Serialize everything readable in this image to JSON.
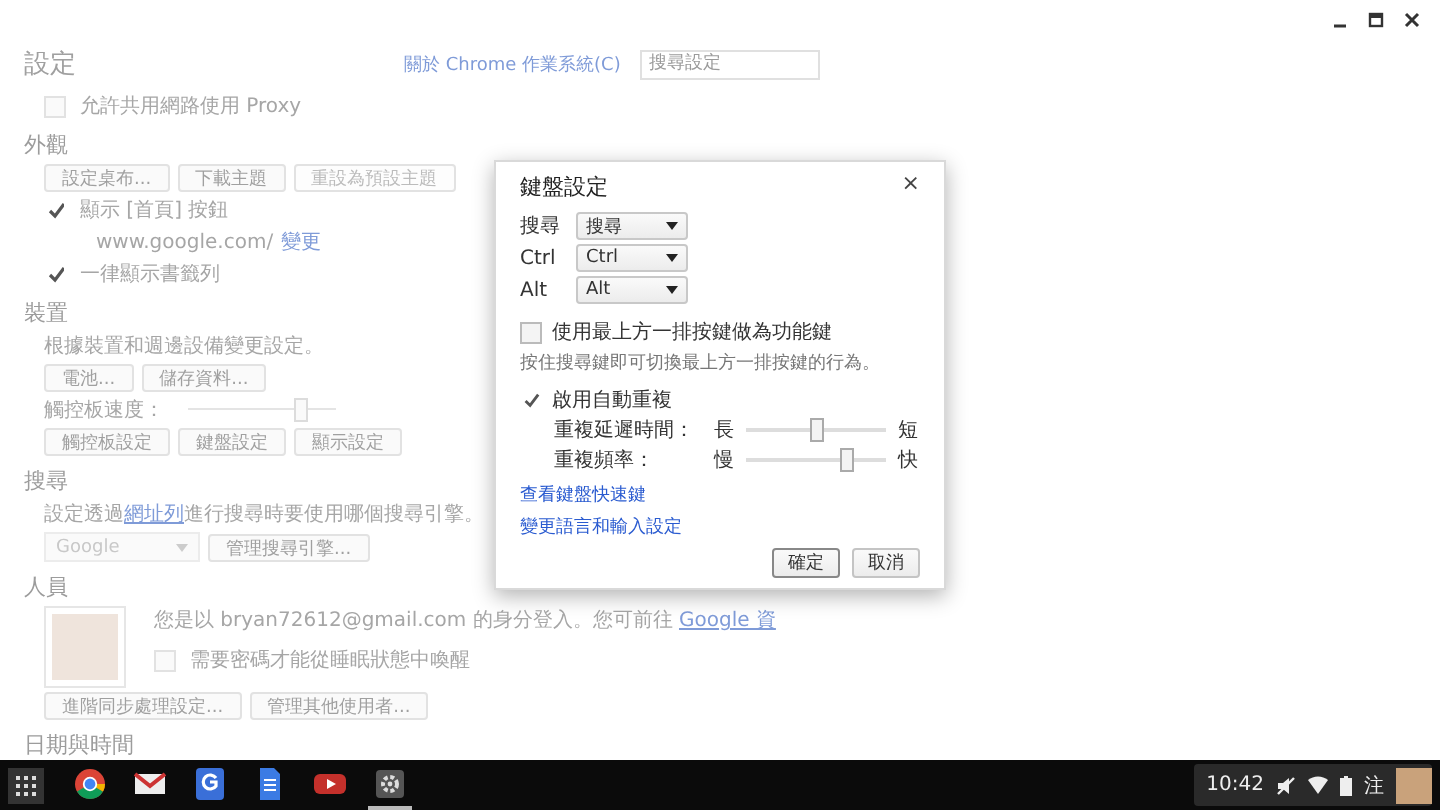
{
  "settings": {
    "title": "設定",
    "about_link": "關於 Chrome 作業系統(C)",
    "search": {
      "placeholder": "搜尋設定"
    },
    "sections": [
      {
        "items": [
          {
            "kind": "checkbox",
            "label": "允許共用網路使用 Proxy",
            "checked": false
          }
        ]
      },
      {
        "heading": "外觀",
        "items": [
          {
            "kind": "buttons",
            "buttons": [
              {
                "label": "設定桌布...",
                "disabled": false
              },
              {
                "label": "下載主題",
                "disabled": false
              },
              {
                "label": "重設為預設主題",
                "disabled": true
              }
            ]
          },
          {
            "kind": "checkbox",
            "label": "顯示 [首頁] 按鈕",
            "checked": true
          },
          {
            "kind": "link_line",
            "text": "www.google.com/",
            "link": "變更"
          },
          {
            "kind": "checkbox",
            "label": "一律顯示書籤列",
            "checked": true
          }
        ]
      },
      {
        "heading": "裝置",
        "items": [
          {
            "kind": "text",
            "text": "根據裝置和週邊設備變更設定。"
          },
          {
            "kind": "buttons",
            "buttons": [
              {
                "label": "電池...",
                "disabled": false
              },
              {
                "label": "儲存資料...",
                "disabled": false
              }
            ]
          },
          {
            "kind": "slider",
            "label": "觸控板速度：",
            "level": 0.75
          },
          {
            "kind": "buttons",
            "buttons": [
              {
                "label": "觸控板設定",
                "disabled": false
              },
              {
                "label": "鍵盤設定",
                "disabled": false
              },
              {
                "label": "顯示設定",
                "disabled": false
              }
            ]
          }
        ]
      },
      {
        "heading": "搜尋",
        "items": [
          {
            "kind": "link_text",
            "before": "設定透過",
            "link": "網址列",
            "after": "進行搜尋時要使用哪個搜尋引擎。"
          },
          {
            "kind": "select_row",
            "select": "Google",
            "button": "管理搜尋引擎..."
          }
        ]
      },
      {
        "heading": "人員",
        "items": [
          {
            "kind": "account",
            "before": "您是以 bryan72612@gmail.com 的身分登入。您可前往 ",
            "link": "Google 資",
            "checkbox": {
              "label": "需要密碼才能從睡眠狀態中喚醒",
              "checked": false
            }
          },
          {
            "kind": "buttons",
            "buttons": [
              {
                "label": "進階同步處理設定...",
                "disabled": false
              },
              {
                "label": "管理其他使用者...",
                "disabled": false
              }
            ]
          }
        ]
      },
      {
        "heading": "日期與時間"
      }
    ]
  },
  "dialog": {
    "title": "鍵盤設定",
    "close": "×",
    "selects": [
      {
        "label": "搜尋",
        "value": "搜尋"
      },
      {
        "label": "Ctrl",
        "value": "Ctrl"
      },
      {
        "label": "Alt",
        "value": "Alt"
      }
    ],
    "function_keys": {
      "label": "使用最上方一排按鍵做為功能鍵",
      "checked": false
    },
    "hint": "按住搜尋鍵即可切換最上方一排按鍵的行為。",
    "auto_repeat": {
      "label": "啟用自動重複",
      "checked": true
    },
    "sliders": [
      {
        "label": "重複延遲時間：",
        "min": "長",
        "max": "短",
        "level": 0.5
      },
      {
        "label": "重複頻率：",
        "min": "慢",
        "max": "快",
        "level": 0.72
      }
    ],
    "links": [
      "查看鍵盤快速鍵",
      "變更語言和輸入設定"
    ],
    "buttons": [
      "確定",
      "取消"
    ]
  },
  "shelf": {
    "apps": [
      {
        "kind": "chrome",
        "selected": false
      },
      {
        "kind": "mail",
        "selected": false
      },
      {
        "kind": "google",
        "selected": false
      },
      {
        "kind": "docs",
        "selected": false
      },
      {
        "kind": "video",
        "selected": false
      },
      {
        "kind": "settings",
        "selected": true
      }
    ],
    "time": "10:42",
    "ime": "注"
  }
}
